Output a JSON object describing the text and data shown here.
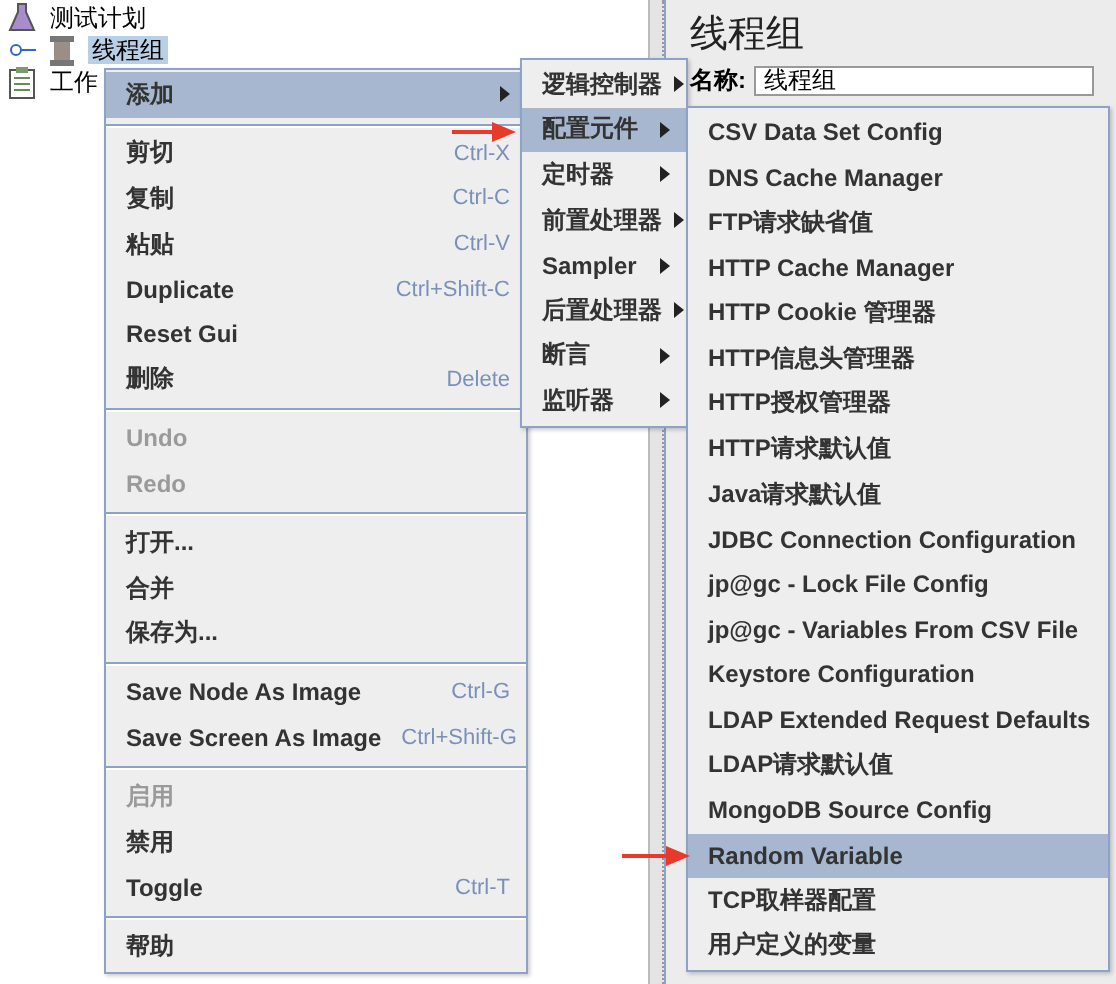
{
  "tree": [
    {
      "label": "测试计划",
      "selected": false,
      "kind": "plan"
    },
    {
      "label": "线程组",
      "selected": true,
      "kind": "group"
    },
    {
      "label": "工作",
      "selected": false,
      "kind": "workbench"
    }
  ],
  "panel": {
    "title": "线程组",
    "name_label": "名称:",
    "name_value": "线程组"
  },
  "context_menu": [
    {
      "kind": "item",
      "label": "添加",
      "selected": true,
      "disabled": false,
      "submenu": true
    },
    {
      "kind": "separator"
    },
    {
      "kind": "item",
      "label": "剪切",
      "shortcut": "Ctrl-X",
      "selected": false,
      "disabled": false,
      "submenu": false
    },
    {
      "kind": "item",
      "label": "复制",
      "shortcut": "Ctrl-C",
      "selected": false,
      "disabled": false,
      "submenu": false
    },
    {
      "kind": "item",
      "label": "粘贴",
      "shortcut": "Ctrl-V",
      "selected": false,
      "disabled": false,
      "submenu": false
    },
    {
      "kind": "item",
      "label": "Duplicate",
      "shortcut": "Ctrl+Shift-C",
      "selected": false,
      "disabled": false,
      "submenu": false
    },
    {
      "kind": "item",
      "label": "Reset Gui",
      "selected": false,
      "disabled": false,
      "submenu": false
    },
    {
      "kind": "item",
      "label": "删除",
      "shortcut": "Delete",
      "selected": false,
      "disabled": false,
      "submenu": false
    },
    {
      "kind": "separator"
    },
    {
      "kind": "item",
      "label": "Undo",
      "selected": false,
      "disabled": true,
      "submenu": false
    },
    {
      "kind": "item",
      "label": "Redo",
      "selected": false,
      "disabled": true,
      "submenu": false
    },
    {
      "kind": "separator"
    },
    {
      "kind": "item",
      "label": "打开...",
      "selected": false,
      "disabled": false,
      "submenu": false
    },
    {
      "kind": "item",
      "label": "合并",
      "selected": false,
      "disabled": false,
      "submenu": false
    },
    {
      "kind": "item",
      "label": "保存为...",
      "selected": false,
      "disabled": false,
      "submenu": false
    },
    {
      "kind": "separator"
    },
    {
      "kind": "item",
      "label": "Save Node As Image",
      "shortcut": "Ctrl-G",
      "selected": false,
      "disabled": false,
      "submenu": false
    },
    {
      "kind": "item",
      "label": "Save Screen As Image",
      "shortcut": "Ctrl+Shift-G",
      "selected": false,
      "disabled": false,
      "submenu": false
    },
    {
      "kind": "separator"
    },
    {
      "kind": "item",
      "label": "启用",
      "selected": false,
      "disabled": true,
      "submenu": false
    },
    {
      "kind": "item",
      "label": "禁用",
      "selected": false,
      "disabled": false,
      "submenu": false
    },
    {
      "kind": "item",
      "label": "Toggle",
      "shortcut": "Ctrl-T",
      "selected": false,
      "disabled": false,
      "submenu": false
    },
    {
      "kind": "separator"
    },
    {
      "kind": "item",
      "label": "帮助",
      "selected": false,
      "disabled": false,
      "submenu": false
    }
  ],
  "add_submenu": [
    {
      "kind": "item",
      "label": "逻辑控制器",
      "selected": false,
      "disabled": false,
      "submenu": true
    },
    {
      "kind": "item",
      "label": "配置元件",
      "selected": true,
      "disabled": false,
      "submenu": true
    },
    {
      "kind": "item",
      "label": "定时器",
      "selected": false,
      "disabled": false,
      "submenu": true
    },
    {
      "kind": "item",
      "label": "前置处理器",
      "selected": false,
      "disabled": false,
      "submenu": true
    },
    {
      "kind": "item",
      "label": "Sampler",
      "selected": false,
      "disabled": false,
      "submenu": true
    },
    {
      "kind": "item",
      "label": "后置处理器",
      "selected": false,
      "disabled": false,
      "submenu": true
    },
    {
      "kind": "item",
      "label": "断言",
      "selected": false,
      "disabled": false,
      "submenu": true
    },
    {
      "kind": "item",
      "label": "监听器",
      "selected": false,
      "disabled": false,
      "submenu": true
    }
  ],
  "config_submenu": [
    {
      "kind": "item",
      "label": "CSV Data Set Config",
      "selected": false,
      "disabled": false,
      "submenu": false
    },
    {
      "kind": "item",
      "label": "DNS Cache Manager",
      "selected": false,
      "disabled": false,
      "submenu": false
    },
    {
      "kind": "item",
      "label": "FTP请求缺省值",
      "selected": false,
      "disabled": false,
      "submenu": false
    },
    {
      "kind": "item",
      "label": "HTTP Cache Manager",
      "selected": false,
      "disabled": false,
      "submenu": false
    },
    {
      "kind": "item",
      "label": "HTTP Cookie 管理器",
      "selected": false,
      "disabled": false,
      "submenu": false
    },
    {
      "kind": "item",
      "label": "HTTP信息头管理器",
      "selected": false,
      "disabled": false,
      "submenu": false
    },
    {
      "kind": "item",
      "label": "HTTP授权管理器",
      "selected": false,
      "disabled": false,
      "submenu": false
    },
    {
      "kind": "item",
      "label": "HTTP请求默认值",
      "selected": false,
      "disabled": false,
      "submenu": false
    },
    {
      "kind": "item",
      "label": "Java请求默认值",
      "selected": false,
      "disabled": false,
      "submenu": false
    },
    {
      "kind": "item",
      "label": "JDBC Connection Configuration",
      "selected": false,
      "disabled": false,
      "submenu": false
    },
    {
      "kind": "item",
      "label": "jp@gc - Lock File Config",
      "selected": false,
      "disabled": false,
      "submenu": false
    },
    {
      "kind": "item",
      "label": "jp@gc - Variables From CSV File",
      "selected": false,
      "disabled": false,
      "submenu": false
    },
    {
      "kind": "item",
      "label": "Keystore Configuration",
      "selected": false,
      "disabled": false,
      "submenu": false
    },
    {
      "kind": "item",
      "label": "LDAP Extended Request Defaults",
      "selected": false,
      "disabled": false,
      "submenu": false
    },
    {
      "kind": "item",
      "label": "LDAP请求默认值",
      "selected": false,
      "disabled": false,
      "submenu": false
    },
    {
      "kind": "item",
      "label": "MongoDB Source Config",
      "selected": false,
      "disabled": false,
      "submenu": false
    },
    {
      "kind": "item",
      "label": "Random Variable",
      "selected": true,
      "disabled": false,
      "submenu": false
    },
    {
      "kind": "item",
      "label": "TCP取样器配置",
      "selected": false,
      "disabled": false,
      "submenu": false
    },
    {
      "kind": "item",
      "label": "用户定义的变量",
      "selected": false,
      "disabled": false,
      "submenu": false
    }
  ]
}
